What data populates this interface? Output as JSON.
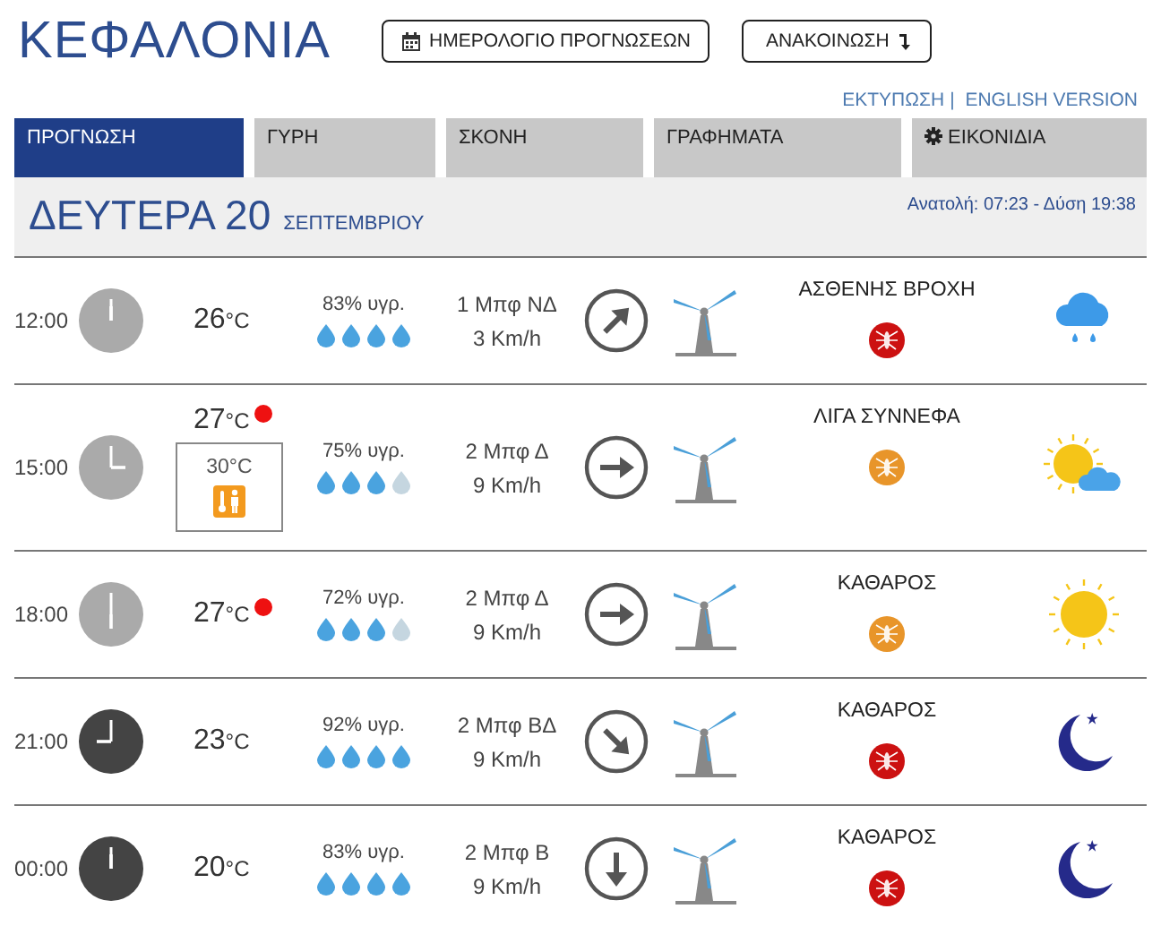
{
  "title": "ΚΕΦΑΛΟΝΙΑ",
  "header_buttons": [
    {
      "label": "ΗΜΕΡΟΛΟΓΙΟ ΠΡΟΓΝΩΣΕΩΝ",
      "kind": "calendar"
    },
    {
      "label": "ΑΝΑΚΟΙΝΩΣΗ",
      "kind": "download"
    }
  ],
  "links": [
    "ΕΚΤΥΠΩΣΗ",
    "ENGLISH VERSION"
  ],
  "link_separator": "|",
  "tabs": [
    {
      "label": "ΠΡΟΓΝΩΣΗ",
      "selected": true
    },
    {
      "label": "ΓΥΡΗ",
      "selected": false
    },
    {
      "label": "ΣΚΟΝΗ",
      "selected": false
    },
    {
      "label": "ΓΡΑΦΗΜΑΤΑ",
      "selected": false
    },
    {
      "label": "ΕΙΚΟΝΙΔΙΑ",
      "selected": false,
      "kind": "gear"
    }
  ],
  "day": {
    "weekday": "ΔΕΥΤΕΡΑ 20",
    "month": "ΣΕΠΤΕΜΒΡΙΟΥ",
    "sun": "Ανατολή: 07:23  - Δύση 19:38"
  },
  "rows": [
    {
      "time": "12:00",
      "night": false,
      "temp": "26",
      "unit": "°C",
      "alert": false,
      "humidity": "83% υγρ.",
      "stars": 4,
      "wind": "1 Μπφ ΝΔ",
      "speed": "3 Km/h",
      "direction": {
        "kind": "northeast"
      },
      "condition": "ΑΣΘΕΝΗΣ ΒΡΟΧΗ",
      "color": "#cc1111",
      "weather": {
        "kind": "rain"
      }
    },
    {
      "time": "15:00",
      "night": false,
      "temp": "27",
      "unit": "°C",
      "alert": true,
      "feels": "30°C",
      "humidity": "75% υγρ.",
      "stars": 3,
      "wind": "2 Μπφ Δ",
      "speed": "9 Km/h",
      "direction": {
        "kind": "east"
      },
      "condition": "ΛΙΓΑ ΣΥΝΝΕΦΑ",
      "color": "#e8952a",
      "weather": {
        "kind": "cloudy"
      }
    },
    {
      "time": "18:00",
      "night": false,
      "temp": "27",
      "unit": "°C",
      "alert": true,
      "humidity": "72% υγρ.",
      "stars": 3,
      "wind": "2 Μπφ Δ",
      "speed": "9 Km/h",
      "direction": {
        "kind": "east"
      },
      "condition": "ΚΑΘΑΡΟΣ",
      "color": "#e8952a",
      "weather": {
        "kind": "sun"
      }
    },
    {
      "time": "21:00",
      "night": true,
      "temp": "23",
      "unit": "°C",
      "alert": false,
      "humidity": "92% υγρ.",
      "stars": 4,
      "wind": "2 Μπφ ΒΔ",
      "speed": "9 Km/h",
      "direction": {
        "kind": "southeast"
      },
      "condition": "ΚΑΘΑΡΟΣ",
      "color": "#cc1111",
      "weather": {
        "kind": "moon"
      }
    },
    {
      "time": "00:00",
      "night": true,
      "temp": "20",
      "unit": "°C",
      "alert": false,
      "humidity": "83% υγρ.",
      "stars": 4,
      "wind": "2 Μπφ Β",
      "speed": "9 Km/h",
      "direction": {
        "kind": "south"
      },
      "condition": "ΚΑΘΑΡΟΣ",
      "color": "#cc1111",
      "weather": {
        "kind": "moon"
      }
    }
  ]
}
